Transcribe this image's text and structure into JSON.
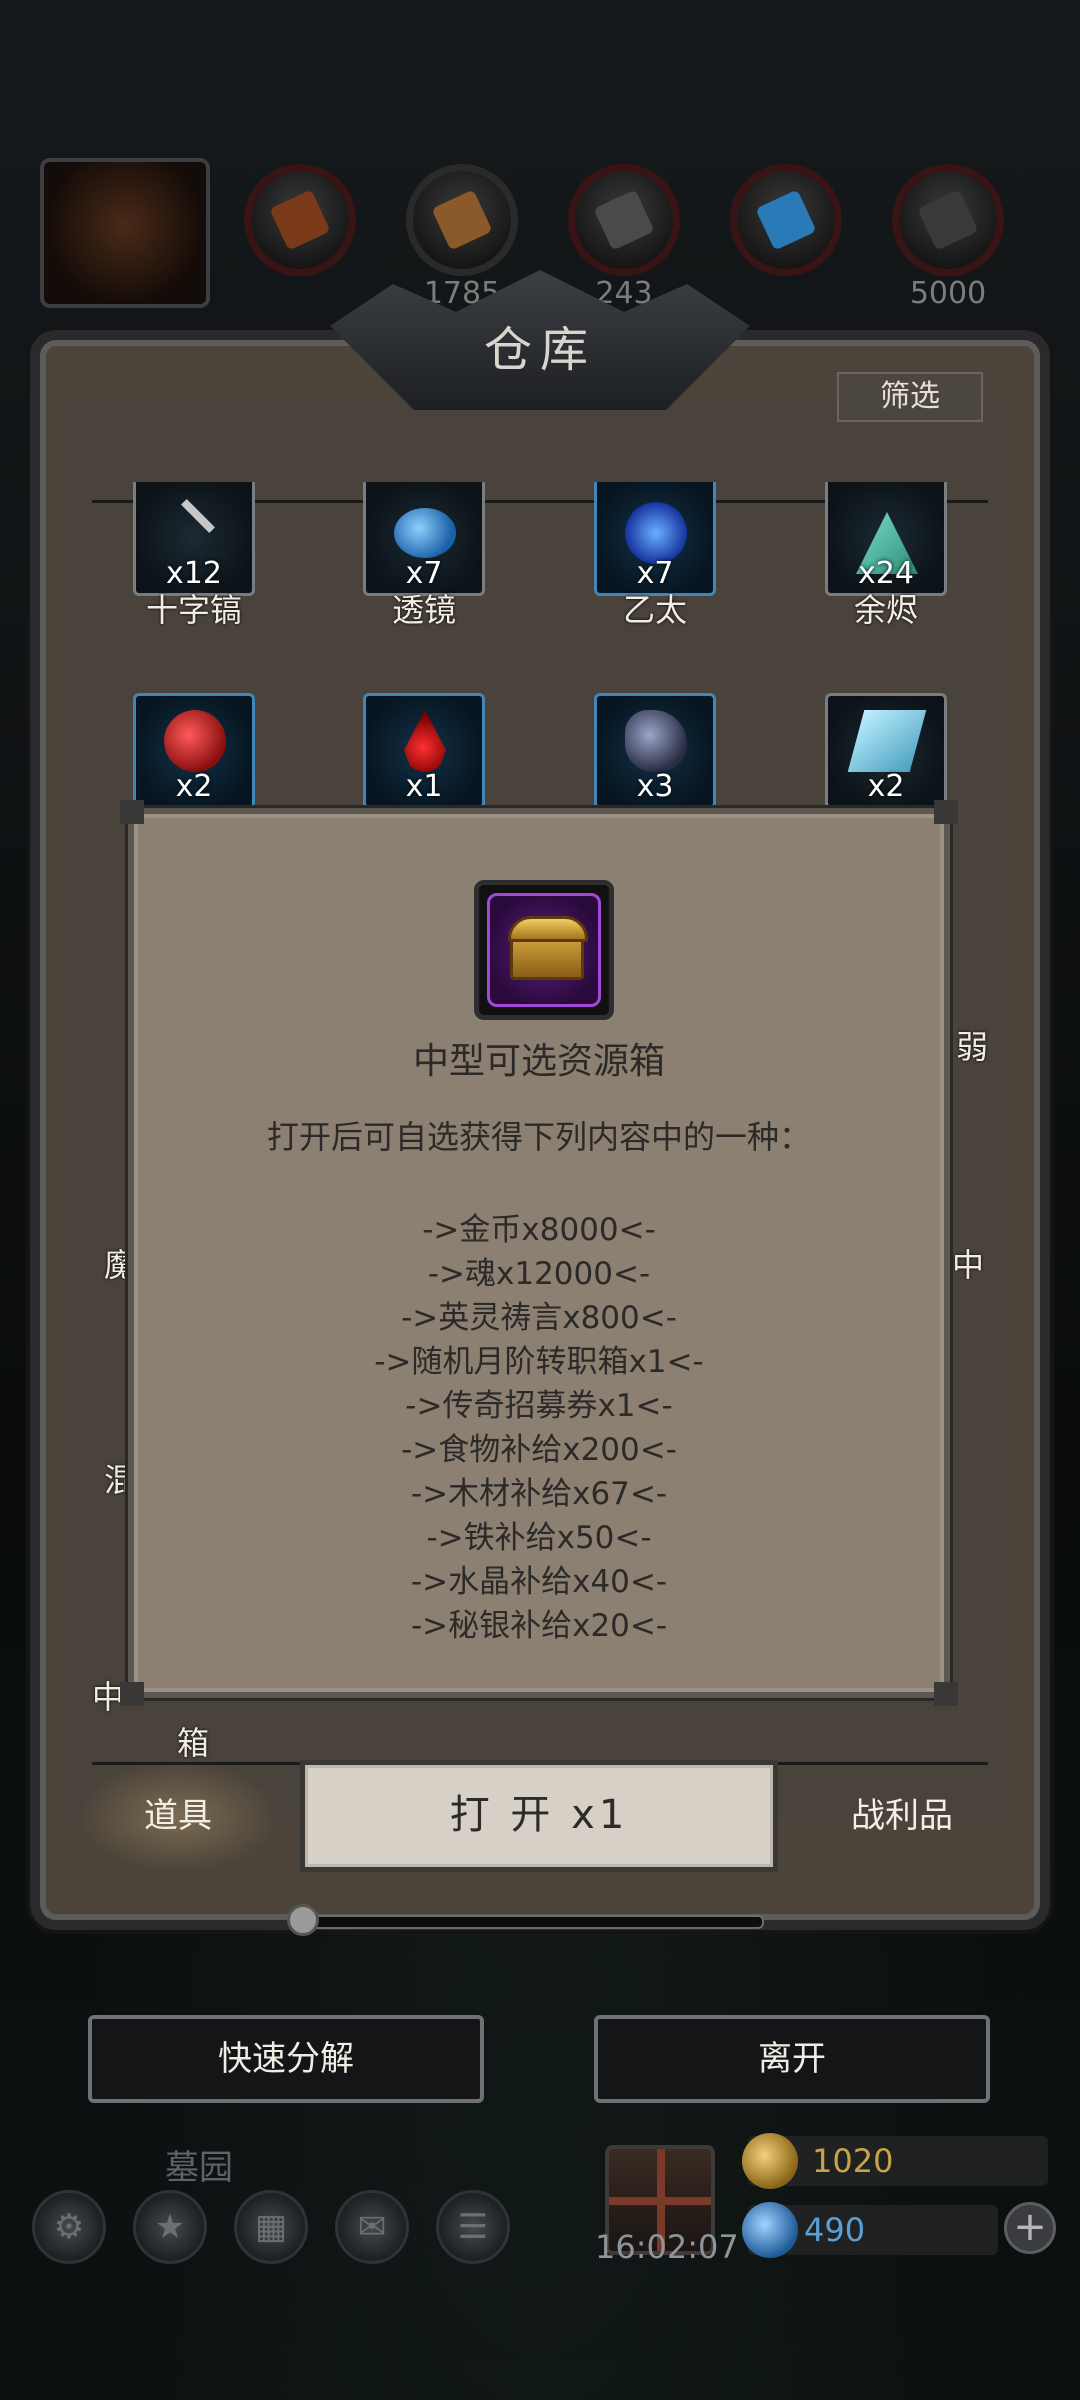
{
  "resources": {
    "values": [
      "1785",
      "243",
      "5000"
    ]
  },
  "warehouse": {
    "title": "仓库",
    "filter_label": "筛选",
    "items_row1": [
      {
        "name": "十字镐",
        "qty": "x12",
        "icon": "pickaxe-icon"
      },
      {
        "name": "透镜",
        "qty": "x7",
        "icon": "lens-icon"
      },
      {
        "name": "乙太",
        "qty": "x7",
        "icon": "ether-icon"
      },
      {
        "name": "余烬",
        "qty": "x24",
        "icon": "ember-icon"
      }
    ],
    "items_row2": [
      {
        "qty": "x2",
        "icon": "red-ore-icon"
      },
      {
        "qty": "x1",
        "icon": "blood-drop-icon"
      },
      {
        "qty": "x3",
        "icon": "dark-ore-icon"
      },
      {
        "qty": "x2",
        "icon": "crystal-ingot-icon"
      }
    ],
    "partial_labels": {
      "right_a": "弱",
      "left_b": "魔",
      "right_b": "中",
      "left_c": "混",
      "left_d": "中",
      "below": "箱"
    }
  },
  "popup": {
    "item_icon": "treasure-chest-icon",
    "title": "中型可选资源箱",
    "description": "打开后可自选获得下列内容中的一种：",
    "options": [
      "->金币x8000<-",
      "->魂x12000<-",
      "->英灵祷言x800<-",
      "->随机月阶转职箱x1<-",
      "->传奇招募券x1<-",
      "->食物补给x200<-",
      "->木材补给x67<-",
      "->铁补给x50<-",
      "->水晶补给x40<-",
      "->秘银补给x20<-"
    ]
  },
  "controls": {
    "open_button": "打 开 x1",
    "tab_items": "道具",
    "tab_loot": "战利品",
    "quick_decompose": "快速分解",
    "leave": "离开"
  },
  "hud": {
    "location": "墓园",
    "clock": "16:02:07",
    "gold": "1020",
    "gems": "490",
    "plus": "+"
  },
  "colors": {
    "gold": "#c9a24a",
    "gem": "#5aa0d8",
    "rare_border": "#a24ad8"
  }
}
